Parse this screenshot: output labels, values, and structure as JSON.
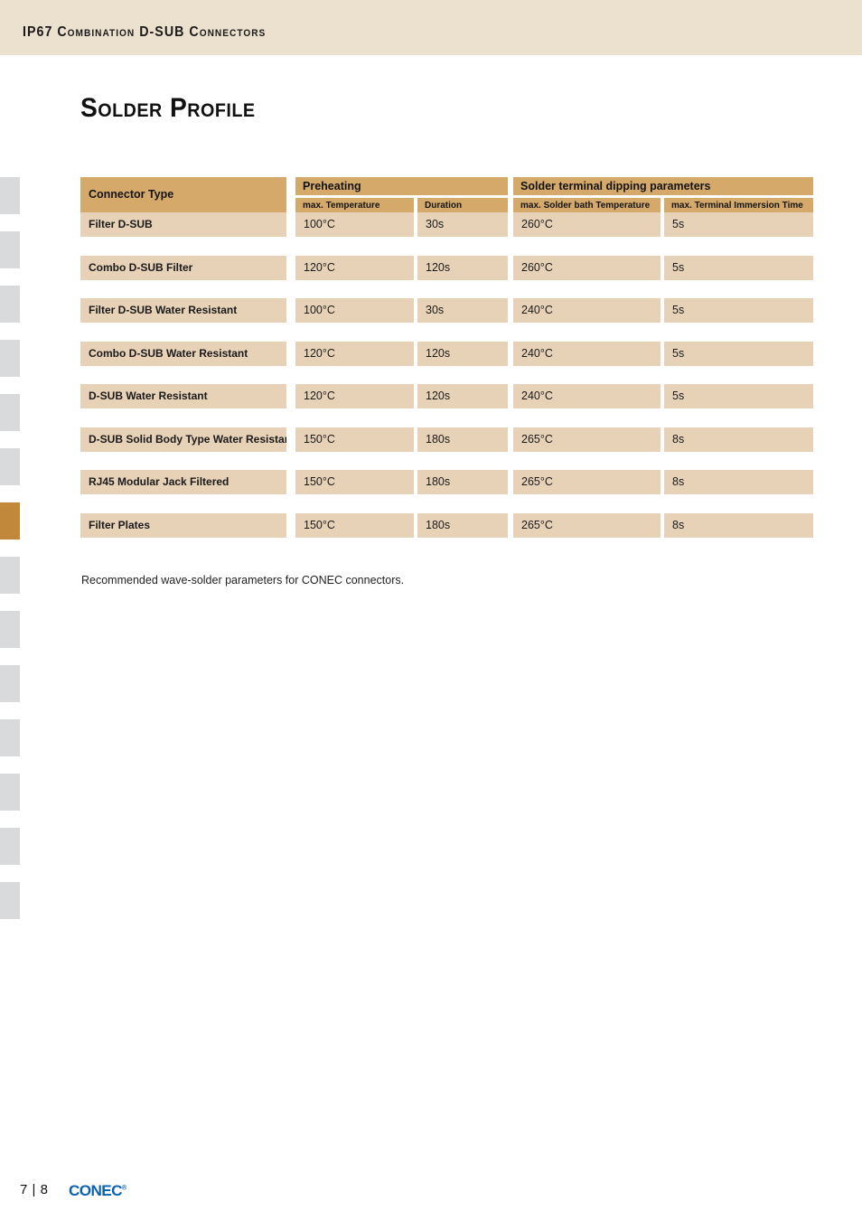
{
  "header": {
    "running_head": "IP67 Combination D-SUB Connectors",
    "band_color": "#ece0ce"
  },
  "title": "Solder Profile",
  "tab_strip": {
    "inactive_color": "#d8dadc",
    "active_color": "#c1873a",
    "active_index": 6,
    "count": 14
  },
  "table": {
    "header_color": "#d4a96a",
    "row_color": "#e7d2b8",
    "columns": {
      "connector_type": "Connector Type",
      "group_preheating": "Preheating",
      "group_dipping": "Solder terminal dipping parameters",
      "sub_max_temperature": "max. Temperature",
      "sub_duration": "Duration",
      "sub_solder_bath_temperature": "max. Solder bath Temperature",
      "sub_terminal_immersion_time": "max. Terminal Immersion Time"
    },
    "rows": [
      {
        "connector_type": "Filter D-SUB",
        "max_temperature": "100°C",
        "duration": "30s",
        "solder_bath_temperature": "260°C",
        "terminal_immersion_time": "5s"
      },
      {
        "connector_type": "Combo D-SUB Filter",
        "max_temperature": "120°C",
        "duration": "120s",
        "solder_bath_temperature": "260°C",
        "terminal_immersion_time": "5s"
      },
      {
        "connector_type": "Filter D-SUB Water Resistant",
        "max_temperature": "100°C",
        "duration": "30s",
        "solder_bath_temperature": "240°C",
        "terminal_immersion_time": "5s"
      },
      {
        "connector_type": "Combo D-SUB Water Resistant",
        "max_temperature": "120°C",
        "duration": "120s",
        "solder_bath_temperature": "240°C",
        "terminal_immersion_time": "5s"
      },
      {
        "connector_type": "D-SUB Water Resistant",
        "max_temperature": "120°C",
        "duration": "120s",
        "solder_bath_temperature": "240°C",
        "terminal_immersion_time": "5s"
      },
      {
        "connector_type": "D-SUB Solid Body Type Water Resistant",
        "max_temperature": "150°C",
        "duration": "180s",
        "solder_bath_temperature": "265°C",
        "terminal_immersion_time": "8s"
      },
      {
        "connector_type": "RJ45 Modular Jack Filtered",
        "max_temperature": "150°C",
        "duration": "180s",
        "solder_bath_temperature": "265°C",
        "terminal_immersion_time": "8s"
      },
      {
        "connector_type": "Filter Plates",
        "max_temperature": "150°C",
        "duration": "180s",
        "solder_bath_temperature": "265°C",
        "terminal_immersion_time": "8s"
      }
    ],
    "caption": "Recommended wave-solder parameters for CONEC connectors."
  },
  "footer": {
    "page_number": "7 | 8",
    "brand": "CONEC",
    "brand_mark": "®",
    "brand_color": "#0a62b0"
  }
}
